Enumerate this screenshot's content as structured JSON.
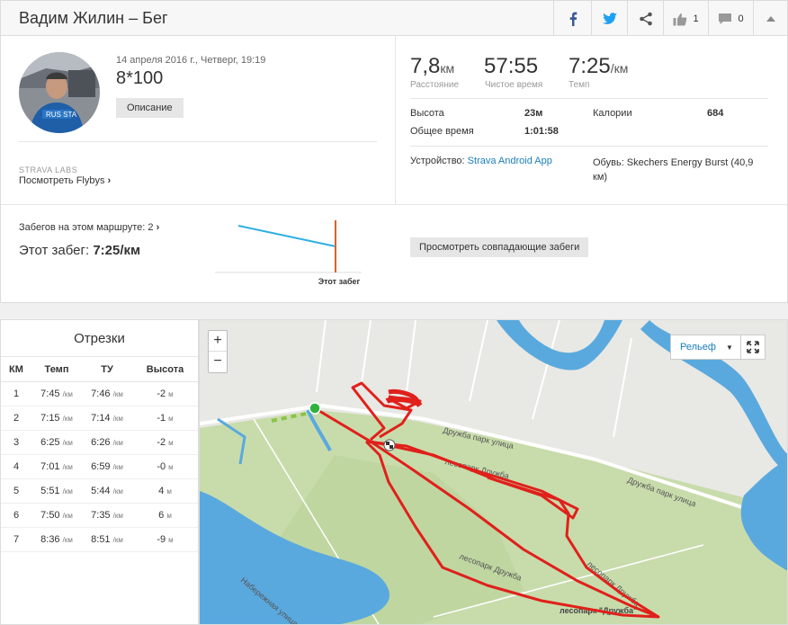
{
  "header": {
    "title": "Вадим Жилин – Бег",
    "kudos_count": "1",
    "comments_count": "0"
  },
  "activity": {
    "date": "14 апреля 2016 г., Четверг, 19:19",
    "name": "8*100",
    "description_button": "Описание",
    "labs_label": "STRAVA LABS",
    "flybys_link": "Посмотреть Flybys",
    "stats": {
      "distance": {
        "value": "7,8",
        "unit": "км",
        "label": "Расстояние"
      },
      "moving_time": {
        "value": "57:55",
        "label": "Чистое время"
      },
      "pace": {
        "value": "7:25",
        "unit": "/км",
        "label": "Темп"
      }
    },
    "details": {
      "elevation_label": "Высота",
      "elevation_value": "23м",
      "elapsed_label": "Общее время",
      "elapsed_value": "1:01:58",
      "calories_label": "Калории",
      "calories_value": "684"
    },
    "device_label": "Устройство:",
    "device_value": "Strava Android App",
    "shoes": "Обувь: Skechers Energy Burst (40,9 км)",
    "route_runs": "Забегов на этом маршруте: 2",
    "this_run_label": "Этот забег:",
    "this_run_value": "7:25/км",
    "this_run_chart_label": "Этот забег",
    "match_button": "Просмотреть совпадающие забеги"
  },
  "splits": {
    "title": "Отрезки",
    "headers": [
      "КМ",
      "Темп",
      "ТУ",
      "Высота"
    ],
    "unit_pace": "/км",
    "unit_elev": "м",
    "rows": [
      [
        "1",
        "7:45",
        "7:46",
        "-2"
      ],
      [
        "2",
        "7:15",
        "7:14",
        "-1"
      ],
      [
        "3",
        "6:25",
        "6:26",
        "-2"
      ],
      [
        "4",
        "7:01",
        "6:59",
        "-0"
      ],
      [
        "5",
        "5:51",
        "5:44",
        "4"
      ],
      [
        "6",
        "7:50",
        "7:35",
        "6"
      ],
      [
        "7",
        "8:36",
        "8:51",
        "-9"
      ]
    ]
  },
  "map": {
    "zoom_in": "+",
    "zoom_out": "−",
    "map_type": "Рельеф",
    "labels": {
      "street1": "Дружба парк улица",
      "street2": "Дружба парк улица",
      "park1": "лесопарк Дружба",
      "park2": "лесопарк Дружба",
      "park3": "лесопарк Дружба",
      "park4": "лесопарк \"Дружба\"",
      "embankment": "Набережная улица"
    },
    "colors": {
      "route": "#e0201b",
      "water": "#5aa9de",
      "park": "#c6dba6"
    }
  }
}
